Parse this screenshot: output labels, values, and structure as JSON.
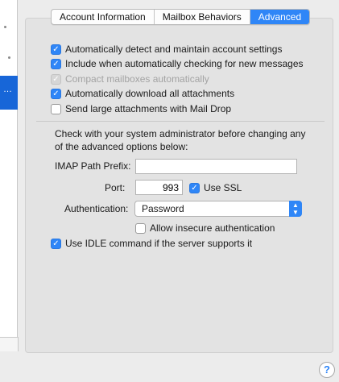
{
  "tabs": [
    {
      "label": "Account Information",
      "active": false
    },
    {
      "label": "Mailbox Behaviors",
      "active": false
    },
    {
      "label": "Advanced",
      "active": true
    }
  ],
  "options": {
    "detect_settings": {
      "label": "Automatically detect and maintain account settings",
      "checked": true,
      "enabled": true
    },
    "include_check": {
      "label": "Include when automatically checking for new messages",
      "checked": true,
      "enabled": true
    },
    "compact": {
      "label": "Compact mailboxes automatically",
      "checked": true,
      "enabled": false
    },
    "download_attachments": {
      "label": "Automatically download all attachments",
      "checked": true,
      "enabled": true
    },
    "mail_drop": {
      "label": "Send large attachments with Mail Drop",
      "checked": false,
      "enabled": true
    }
  },
  "advanced_note": "Check with your system administrator before changing any of the advanced options below:",
  "imap_path": {
    "label": "IMAP Path Prefix:",
    "value": ""
  },
  "port": {
    "label": "Port:",
    "value": "993"
  },
  "use_ssl": {
    "label": "Use SSL",
    "checked": true
  },
  "authentication": {
    "label": "Authentication:",
    "value": "Password"
  },
  "allow_insecure": {
    "label": "Allow insecure authentication",
    "checked": false
  },
  "idle": {
    "label": "Use IDLE command if the server supports it",
    "checked": true
  },
  "help_glyph": "?",
  "colors": {
    "accent": "#2f86f7",
    "selection": "#1766d8"
  }
}
